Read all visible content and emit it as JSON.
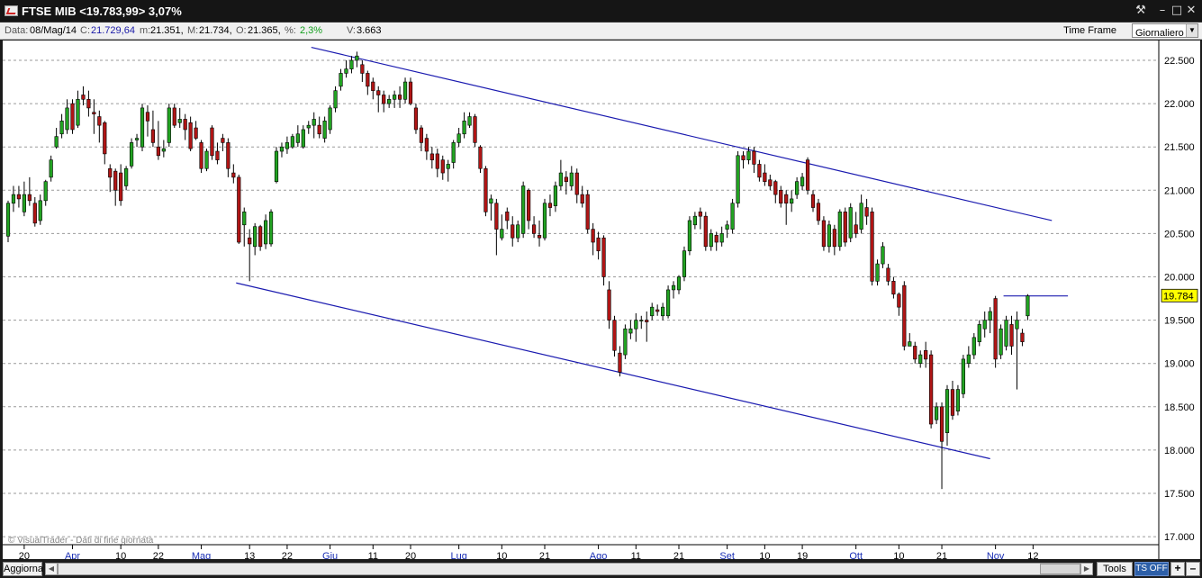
{
  "window": {
    "title": "FTSE MIB <19.783,99> 3,07%",
    "controls": {
      "tool": "⚒",
      "minimize": "–",
      "maximize": "□",
      "close": "✕"
    }
  },
  "info": {
    "data_label": "Data:",
    "data_value": "08/Mag/14",
    "close_label": "C:",
    "close_value": "21.729,64",
    "min_label": "m:",
    "min_value": "21.351,",
    "max_label": "M:",
    "max_value": "21.734,",
    "open_label": "O:",
    "open_value": "21.365,",
    "pct_label": "%:",
    "pct_value": "2,3%",
    "vol_label": "V:",
    "vol_value": "3.663",
    "time_frame_label": "Time Frame",
    "time_frame_value": "Giornaliero"
  },
  "watermark": "© VisualTrader - Dati di fine giornata",
  "bottom": {
    "refresh_label": "Aggiorna",
    "tools_label": "Tools",
    "ts_label": "TS OFF",
    "plus": "+",
    "minus": "–",
    "arrow_left": "◀",
    "arrow_right": "▶"
  },
  "colors": {
    "up": "#22a322",
    "down": "#b01515",
    "trendline": "#1b1bb0",
    "price_tag": "#ffff00",
    "month_label": "#1a2fb5"
  },
  "chart_data": {
    "type": "candlestick",
    "instrument": "FTSE MIB",
    "last_price_tag": "19.784",
    "ylim": [
      16.9,
      22.75
    ],
    "y_ticks": [
      {
        "value": 22.5,
        "label": "22.500"
      },
      {
        "value": 22.0,
        "label": "22.000"
      },
      {
        "value": 21.5,
        "label": "21.500"
      },
      {
        "value": 21.0,
        "label": "21.000"
      },
      {
        "value": 20.5,
        "label": "20.500"
      },
      {
        "value": 20.0,
        "label": "20.000"
      },
      {
        "value": 19.5,
        "label": "19.500"
      },
      {
        "value": 19.0,
        "label": "19.000"
      },
      {
        "value": 18.5,
        "label": "18.500"
      },
      {
        "value": 18.0,
        "label": "18.000"
      },
      {
        "value": 17.5,
        "label": "17.500"
      },
      {
        "value": 17.0,
        "label": "17.000"
      }
    ],
    "x_ticks": [
      {
        "i": 3,
        "label": "20",
        "month": false
      },
      {
        "i": 12,
        "label": "Apr",
        "month": true
      },
      {
        "i": 21,
        "label": "10",
        "month": false
      },
      {
        "i": 28,
        "label": "22",
        "month": false
      },
      {
        "i": 36,
        "label": "Mag",
        "month": true
      },
      {
        "i": 45,
        "label": "13",
        "month": false
      },
      {
        "i": 52,
        "label": "22",
        "month": false
      },
      {
        "i": 60,
        "label": "Giu",
        "month": true
      },
      {
        "i": 68,
        "label": "11",
        "month": false
      },
      {
        "i": 75,
        "label": "20",
        "month": false
      },
      {
        "i": 84,
        "label": "Lug",
        "month": true
      },
      {
        "i": 92,
        "label": "10",
        "month": false
      },
      {
        "i": 100,
        "label": "21",
        "month": false
      },
      {
        "i": 110,
        "label": "Ago",
        "month": true
      },
      {
        "i": 117,
        "label": "11",
        "month": false
      },
      {
        "i": 125,
        "label": "21",
        "month": false
      },
      {
        "i": 134,
        "label": "Set",
        "month": true
      },
      {
        "i": 141,
        "label": "10",
        "month": false
      },
      {
        "i": 148,
        "label": "19",
        "month": false
      },
      {
        "i": 158,
        "label": "Ott",
        "month": true
      },
      {
        "i": 166,
        "label": "10",
        "month": false
      },
      {
        "i": 174,
        "label": "21",
        "month": false
      },
      {
        "i": 184,
        "label": "Nov",
        "month": true
      },
      {
        "i": 191,
        "label": "12",
        "month": false
      }
    ],
    "candles": [
      [
        20.47,
        20.85,
        20.88,
        20.4
      ],
      [
        20.85,
        20.95,
        21.05,
        20.75
      ],
      [
        20.95,
        20.9,
        21.05,
        20.8
      ],
      [
        20.75,
        20.95,
        21.1,
        20.7
      ],
      [
        20.95,
        20.88,
        21.15,
        20.82
      ],
      [
        20.85,
        20.62,
        20.92,
        20.58
      ],
      [
        20.65,
        20.88,
        20.95,
        20.6
      ],
      [
        20.88,
        21.1,
        21.12,
        20.82
      ],
      [
        21.15,
        21.35,
        21.4,
        21.1
      ],
      [
        21.5,
        21.62,
        21.72,
        21.48
      ],
      [
        21.65,
        21.8,
        21.88,
        21.6
      ],
      [
        21.7,
        21.95,
        22.05,
        21.65
      ],
      [
        22.0,
        21.7,
        22.05,
        21.65
      ],
      [
        21.75,
        22.05,
        22.15,
        21.72
      ],
      [
        22.1,
        22.05,
        22.2,
        21.98
      ],
      [
        22.05,
        21.95,
        22.15,
        21.85
      ],
      [
        21.9,
        21.88,
        22.05,
        21.65
      ],
      [
        21.85,
        21.75,
        21.92,
        21.55
      ],
      [
        21.78,
        21.42,
        21.8,
        21.3
      ],
      [
        21.25,
        21.15,
        21.3,
        20.98
      ],
      [
        21.22,
        21.0,
        21.25,
        20.82
      ],
      [
        21.2,
        20.88,
        21.3,
        20.82
      ],
      [
        21.05,
        21.25,
        21.28,
        21.0
      ],
      [
        21.28,
        21.55,
        21.6,
        21.25
      ],
      [
        21.58,
        21.6,
        21.65,
        21.5
      ],
      [
        21.5,
        21.95,
        22.0,
        21.45
      ],
      [
        21.9,
        21.8,
        21.98,
        21.62
      ],
      [
        21.7,
        21.55,
        21.92,
        21.5
      ],
      [
        21.5,
        21.4,
        21.8,
        21.35
      ],
      [
        21.45,
        21.48,
        21.58,
        21.38
      ],
      [
        21.55,
        21.95,
        22.0,
        21.5
      ],
      [
        21.95,
        21.75,
        22.0,
        21.72
      ],
      [
        21.78,
        21.82,
        21.95,
        21.72
      ],
      [
        21.82,
        21.7,
        21.88,
        21.58
      ],
      [
        21.78,
        21.48,
        21.85,
        21.45
      ],
      [
        21.72,
        21.6,
        21.8,
        21.58
      ],
      [
        21.55,
        21.25,
        21.58,
        21.2
      ],
      [
        21.25,
        21.45,
        21.48,
        21.22
      ],
      [
        21.72,
        21.4,
        21.75,
        21.35
      ],
      [
        21.45,
        21.35,
        21.55,
        21.3
      ],
      [
        21.6,
        21.55,
        21.65,
        21.45
      ],
      [
        21.55,
        21.25,
        21.6,
        21.15
      ],
      [
        21.2,
        21.15,
        21.3,
        21.08
      ],
      [
        21.15,
        20.4,
        21.18,
        20.38
      ],
      [
        20.6,
        20.75,
        20.8,
        20.35
      ],
      [
        20.45,
        20.38,
        20.55,
        19.95
      ],
      [
        20.35,
        20.58,
        20.62,
        20.25
      ],
      [
        20.58,
        20.35,
        20.6,
        20.3
      ],
      [
        20.38,
        20.65,
        20.72,
        20.32
      ],
      [
        20.38,
        20.75,
        20.78,
        20.35
      ],
      [
        21.1,
        21.45,
        21.5,
        21.08
      ],
      [
        21.45,
        21.5,
        21.55,
        21.38
      ],
      [
        21.48,
        21.55,
        21.62,
        21.42
      ],
      [
        21.5,
        21.62,
        21.65,
        21.48
      ],
      [
        21.55,
        21.65,
        21.75,
        21.5
      ],
      [
        21.5,
        21.7,
        21.75,
        21.48
      ],
      [
        21.72,
        21.75,
        21.8,
        21.65
      ],
      [
        21.75,
        21.82,
        21.9,
        21.6
      ],
      [
        21.75,
        21.65,
        21.85,
        21.6
      ],
      [
        21.6,
        21.8,
        21.85,
        21.55
      ],
      [
        21.7,
        21.95,
        21.98,
        21.65
      ],
      [
        21.95,
        22.15,
        22.2,
        21.9
      ],
      [
        22.2,
        22.35,
        22.4,
        22.15
      ],
      [
        22.35,
        22.4,
        22.5,
        22.3
      ],
      [
        22.4,
        22.5,
        22.55,
        22.35
      ],
      [
        22.5,
        22.55,
        22.6,
        22.42
      ],
      [
        22.45,
        22.35,
        22.5,
        22.25
      ],
      [
        22.35,
        22.2,
        22.38,
        22.1
      ],
      [
        22.25,
        22.15,
        22.3,
        22.05
      ],
      [
        22.15,
        22.1,
        22.2,
        21.9
      ],
      [
        22.1,
        22.0,
        22.15,
        21.9
      ],
      [
        22.0,
        22.05,
        22.1,
        21.95
      ],
      [
        22.05,
        22.1,
        22.15,
        21.95
      ],
      [
        22.1,
        22.05,
        22.2,
        21.95
      ],
      [
        22.05,
        22.25,
        22.3,
        22.0
      ],
      [
        22.25,
        22.0,
        22.3,
        21.98
      ],
      [
        21.95,
        21.7,
        22.0,
        21.65
      ],
      [
        21.72,
        21.55,
        21.75,
        21.45
      ],
      [
        21.6,
        21.45,
        21.65,
        21.35
      ],
      [
        21.42,
        21.35,
        21.5,
        21.25
      ],
      [
        21.42,
        21.25,
        21.48,
        21.15
      ],
      [
        21.35,
        21.2,
        21.4,
        21.12
      ],
      [
        21.25,
        21.3,
        21.35,
        21.1
      ],
      [
        21.32,
        21.55,
        21.58,
        21.25
      ],
      [
        21.55,
        21.65,
        21.72,
        21.5
      ],
      [
        21.65,
        21.8,
        21.9,
        21.6
      ],
      [
        21.75,
        21.85,
        21.9,
        21.72
      ],
      [
        21.85,
        21.55,
        21.88,
        21.5
      ],
      [
        21.5,
        21.25,
        21.52,
        21.2
      ],
      [
        21.25,
        20.75,
        21.28,
        20.7
      ],
      [
        20.85,
        20.9,
        20.95,
        20.65
      ],
      [
        20.85,
        20.55,
        20.9,
        20.25
      ],
      [
        20.45,
        20.55,
        20.72,
        20.42
      ],
      [
        20.75,
        20.65,
        20.8,
        20.55
      ],
      [
        20.6,
        20.45,
        20.7,
        20.35
      ],
      [
        20.45,
        20.6,
        20.65,
        20.4
      ],
      [
        20.5,
        21.05,
        21.1,
        20.45
      ],
      [
        21.0,
        20.65,
        21.02,
        20.55
      ],
      [
        20.6,
        20.5,
        20.7,
        20.45
      ],
      [
        20.48,
        20.45,
        20.65,
        20.35
      ],
      [
        20.45,
        20.85,
        20.9,
        20.42
      ],
      [
        20.85,
        20.8,
        20.95,
        20.7
      ],
      [
        20.82,
        21.05,
        21.1,
        20.75
      ],
      [
        21.05,
        21.2,
        21.35,
        21.0
      ],
      [
        21.15,
        21.1,
        21.22,
        20.95
      ],
      [
        21.05,
        21.2,
        21.28,
        21.0
      ],
      [
        21.2,
        20.95,
        21.25,
        20.85
      ],
      [
        20.95,
        20.85,
        21.05,
        20.8
      ],
      [
        20.95,
        20.55,
        21.0,
        20.5
      ],
      [
        20.55,
        20.4,
        20.62,
        20.25
      ],
      [
        20.45,
        20.3,
        20.52,
        20.2
      ],
      [
        20.45,
        20.0,
        20.48,
        19.9
      ],
      [
        19.85,
        19.5,
        19.95,
        19.4
      ],
      [
        19.5,
        19.15,
        19.55,
        19.08
      ],
      [
        19.12,
        18.9,
        19.2,
        18.85
      ],
      [
        19.1,
        19.4,
        19.45,
        19.05
      ],
      [
        19.35,
        19.4,
        19.5,
        19.28
      ],
      [
        19.4,
        19.5,
        19.58,
        19.25
      ],
      [
        19.5,
        19.5,
        19.55,
        19.4
      ],
      [
        19.5,
        19.48,
        19.6,
        19.25
      ],
      [
        19.55,
        19.65,
        19.7,
        19.5
      ],
      [
        19.62,
        19.6,
        19.68,
        19.55
      ],
      [
        19.55,
        19.65,
        19.7,
        19.5
      ],
      [
        19.55,
        19.85,
        19.9,
        19.52
      ],
      [
        19.85,
        19.9,
        19.95,
        19.75
      ],
      [
        19.85,
        20.0,
        20.02,
        19.8
      ],
      [
        20.0,
        20.3,
        20.35,
        19.95
      ],
      [
        20.3,
        20.65,
        20.7,
        20.25
      ],
      [
        20.6,
        20.7,
        20.75,
        20.55
      ],
      [
        20.75,
        20.7,
        20.8,
        20.55
      ],
      [
        20.7,
        20.35,
        20.75,
        20.3
      ],
      [
        20.35,
        20.5,
        20.55,
        20.3
      ],
      [
        20.48,
        20.4,
        20.52,
        20.3
      ],
      [
        20.4,
        20.5,
        20.58,
        20.35
      ],
      [
        20.55,
        20.6,
        20.65,
        20.45
      ],
      [
        20.55,
        20.85,
        20.9,
        20.5
      ],
      [
        20.85,
        21.4,
        21.45,
        20.8
      ],
      [
        21.4,
        21.35,
        21.45,
        21.25
      ],
      [
        21.35,
        21.45,
        21.5,
        21.3
      ],
      [
        21.45,
        21.3,
        21.5,
        21.2
      ],
      [
        21.3,
        21.15,
        21.35,
        21.1
      ],
      [
        21.2,
        21.1,
        21.3,
        21.05
      ],
      [
        21.12,
        21.05,
        21.18,
        21.0
      ],
      [
        21.1,
        20.95,
        21.12,
        20.85
      ],
      [
        21.0,
        20.85,
        21.05,
        20.8
      ],
      [
        20.95,
        20.85,
        21.0,
        20.6
      ],
      [
        20.85,
        20.9,
        21.0,
        20.75
      ],
      [
        20.95,
        21.1,
        21.15,
        20.9
      ],
      [
        21.05,
        21.15,
        21.2,
        21.0
      ],
      [
        21.35,
        21.0,
        21.38,
        20.95
      ],
      [
        20.95,
        20.8,
        21.0,
        20.75
      ],
      [
        20.85,
        20.65,
        20.9,
        20.6
      ],
      [
        20.65,
        20.35,
        20.7,
        20.3
      ],
      [
        20.35,
        20.6,
        20.65,
        20.28
      ],
      [
        20.55,
        20.35,
        20.6,
        20.25
      ],
      [
        20.35,
        20.75,
        20.78,
        20.3
      ],
      [
        20.75,
        20.4,
        20.8,
        20.35
      ],
      [
        20.45,
        20.8,
        20.85,
        20.4
      ],
      [
        20.6,
        20.5,
        20.75,
        20.45
      ],
      [
        20.55,
        20.85,
        20.95,
        20.5
      ],
      [
        20.8,
        20.7,
        20.9,
        20.6
      ],
      [
        20.75,
        19.95,
        20.8,
        19.9
      ],
      [
        19.95,
        20.15,
        20.2,
        19.9
      ],
      [
        20.15,
        20.35,
        20.4,
        20.1
      ],
      [
        20.1,
        19.95,
        20.15,
        19.9
      ],
      [
        19.95,
        19.8,
        20.0,
        19.75
      ],
      [
        19.8,
        19.65,
        19.82,
        19.55
      ],
      [
        19.9,
        19.2,
        19.95,
        19.15
      ],
      [
        19.2,
        19.25,
        19.35,
        19.2
      ],
      [
        19.2,
        19.05,
        19.25,
        19.0
      ],
      [
        19.0,
        19.1,
        19.15,
        18.95
      ],
      [
        19.15,
        19.05,
        19.25,
        18.95
      ],
      [
        19.1,
        18.3,
        19.15,
        18.25
      ],
      [
        18.35,
        18.5,
        18.55,
        18.3
      ],
      [
        18.5,
        18.1,
        18.55,
        17.55
      ],
      [
        18.2,
        18.7,
        18.75,
        18.05
      ],
      [
        18.7,
        18.4,
        18.8,
        18.35
      ],
      [
        18.45,
        18.7,
        18.75,
        18.4
      ],
      [
        18.65,
        19.05,
        19.1,
        18.6
      ],
      [
        19.0,
        19.1,
        19.2,
        18.95
      ],
      [
        19.1,
        19.3,
        19.35,
        19.05
      ],
      [
        19.25,
        19.45,
        19.5,
        19.2
      ],
      [
        19.4,
        19.5,
        19.6,
        19.3
      ],
      [
        19.5,
        19.6,
        19.65,
        19.35
      ],
      [
        19.75,
        19.05,
        19.78,
        18.95
      ],
      [
        19.1,
        19.4,
        19.45,
        19.05
      ],
      [
        19.2,
        19.5,
        19.55,
        19.15
      ],
      [
        19.45,
        19.2,
        19.55,
        19.1
      ],
      [
        19.4,
        19.5,
        19.6,
        18.7
      ],
      [
        19.35,
        19.25,
        19.4,
        19.2
      ],
      [
        19.55,
        19.78,
        19.8,
        19.5
      ]
    ],
    "trendlines": [
      {
        "i1": 56.5,
        "v1": 22.65,
        "i2": 194.5,
        "v2": 20.65
      },
      {
        "i1": 42.5,
        "v1": 19.93,
        "i2": 183.0,
        "v2": 17.9
      },
      {
        "i1": 185.5,
        "v1": 19.78,
        "i2": 197.5,
        "v2": 19.78
      }
    ]
  }
}
